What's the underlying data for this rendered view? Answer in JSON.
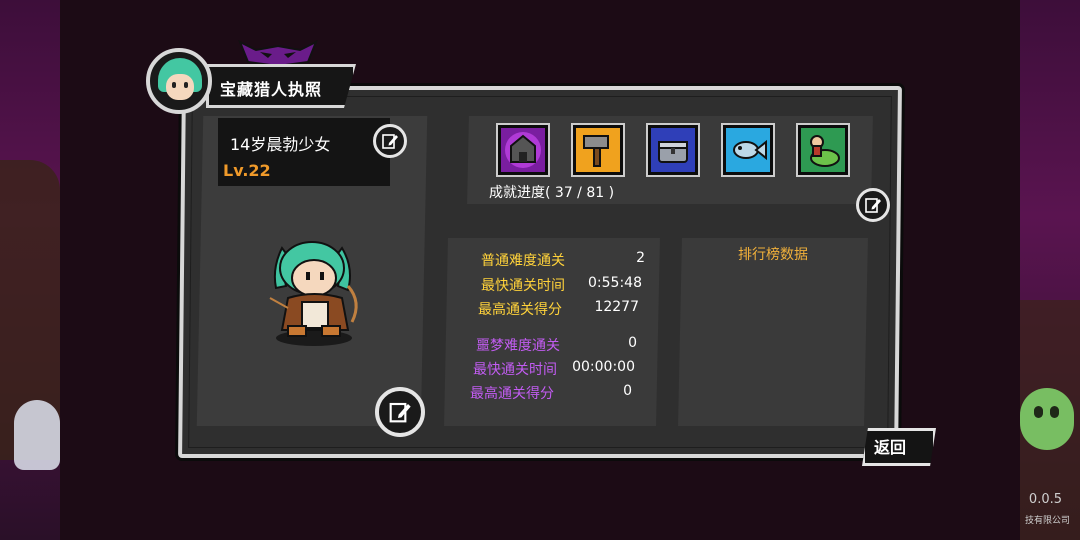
{
  "header": {
    "title": "宝藏猎人执照"
  },
  "character": {
    "name": "14岁晨勃少女",
    "level": "Lv.22"
  },
  "achievements": {
    "progress_label": "成就进度( 37 / 81 )",
    "icons": [
      {
        "name": "haunted-house-icon",
        "color": "#b03ad6"
      },
      {
        "name": "hammer-icon",
        "color": "#f0a21e"
      },
      {
        "name": "treasure-chest-icon",
        "color": "#3a4fd0"
      },
      {
        "name": "fish-icon",
        "color": "#2aa8e0"
      },
      {
        "name": "dragon-rider-icon",
        "color": "#2e9a52"
      }
    ]
  },
  "stats": {
    "normal": {
      "clears_label": "普通难度通关",
      "clears_value": "2",
      "fastest_label": "最快通关时间",
      "fastest_value": "0:55:48",
      "score_label": "最高通关得分",
      "score_value": "12277"
    },
    "nightmare": {
      "clears_label": "噩梦难度通关",
      "clears_value": "0",
      "fastest_label": "最快通关时间",
      "fastest_value": "00:00:00",
      "score_label": "最高通关得分",
      "score_value": "0"
    }
  },
  "leaderboard": {
    "title": "排行榜数据"
  },
  "back_button": {
    "label": "返回"
  },
  "footer": {
    "version": "0.0.5",
    "company": "技有限公司"
  },
  "colors": {
    "accent_gold": "#ffd23a",
    "accent_purple": "#c25cf2",
    "level_orange": "#f09a2a"
  }
}
